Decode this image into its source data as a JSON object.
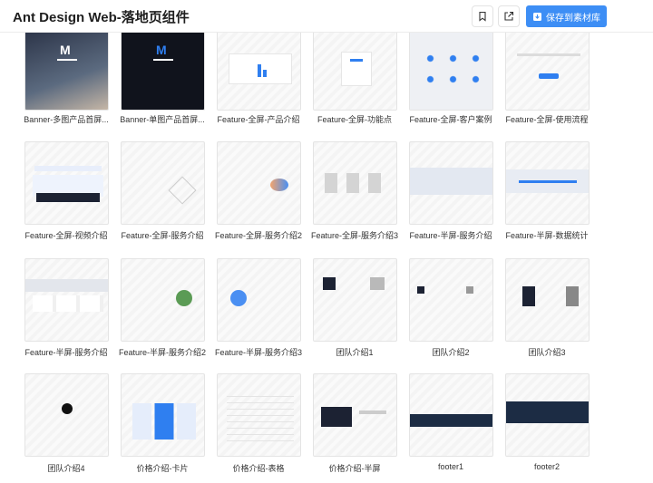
{
  "header": {
    "title": "Ant Design Web-落地页组件",
    "bookmark_icon": "bookmark-icon",
    "share_icon": "external-link-icon",
    "save_label": "保存到素材库",
    "save_icon": "download-icon",
    "accent": "#3d8ef5"
  },
  "components": [
    {
      "label": "Banner-多图产品首屏..."
    },
    {
      "label": "Banner-单图产品首屏..."
    },
    {
      "label": "Feature-全屏-产品介绍"
    },
    {
      "label": "Feature-全屏-功能点"
    },
    {
      "label": "Feature-全屏-客户案例"
    },
    {
      "label": "Feature-全屏-使用流程"
    },
    {
      "label": "Feature-全屏-视频介绍"
    },
    {
      "label": "Feature-全屏-服务介绍"
    },
    {
      "label": "Feature-全屏-服务介绍2"
    },
    {
      "label": "Feature-全屏-服务介绍3"
    },
    {
      "label": "Feature-半屏-服务介绍"
    },
    {
      "label": "Feature-半屏-数据统计"
    },
    {
      "label": "Feature-半屏-服务介绍"
    },
    {
      "label": "Feature-半屏-服务介绍2"
    },
    {
      "label": "Feature-半屏-服务介绍3"
    },
    {
      "label": "团队介绍1"
    },
    {
      "label": "团队介绍2"
    },
    {
      "label": "团队介绍3"
    },
    {
      "label": "团队介绍4"
    },
    {
      "label": "价格介绍-卡片"
    },
    {
      "label": "价格介绍-表格"
    },
    {
      "label": "价格介绍-半屏"
    },
    {
      "label": "footer1"
    },
    {
      "label": "footer2"
    }
  ]
}
